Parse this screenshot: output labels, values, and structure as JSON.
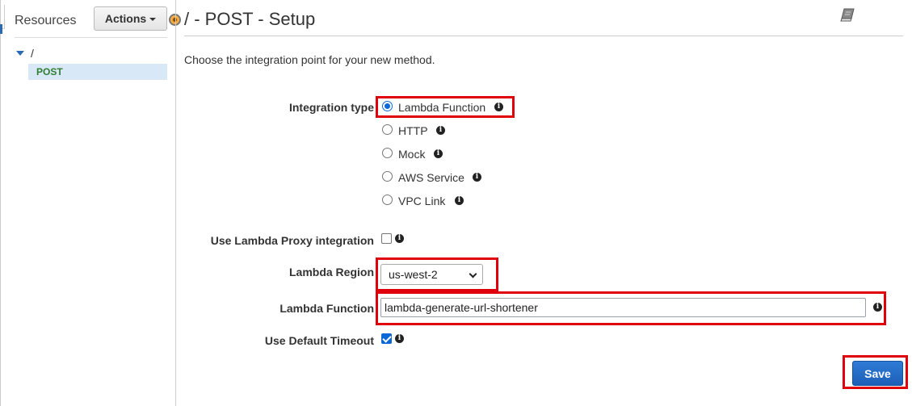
{
  "left_panel": {
    "title": "Resources",
    "actions_label": "Actions",
    "tree": {
      "root_label": "/",
      "method_label": "POST"
    }
  },
  "header": {
    "title": "/ - POST - Setup"
  },
  "main": {
    "intro": "Choose the integration point for your new method.",
    "integration_type": {
      "label": "Integration type",
      "selected": "Lambda Function",
      "options": [
        {
          "label": "Lambda Function",
          "checked": true
        },
        {
          "label": "HTTP",
          "checked": false
        },
        {
          "label": "Mock",
          "checked": false
        },
        {
          "label": "AWS Service",
          "checked": false
        },
        {
          "label": "VPC Link",
          "checked": false
        }
      ]
    },
    "lambda_proxy": {
      "label": "Use Lambda Proxy integration",
      "checked": false
    },
    "lambda_region": {
      "label": "Lambda Region",
      "value": "us-west-2"
    },
    "lambda_function": {
      "label": "Lambda Function",
      "value": "lambda-generate-url-shortener"
    },
    "default_timeout": {
      "label": "Use Default Timeout",
      "checked": true
    },
    "save_label": "Save"
  },
  "icons": {
    "info": "info-icon",
    "book": "book-icon",
    "tree_toggle": "triangle-down-icon"
  },
  "colors": {
    "accent": "#0b68d6",
    "highlight": "#e0000b",
    "method": "#2f7d32",
    "selection": "#d9e8f6"
  }
}
